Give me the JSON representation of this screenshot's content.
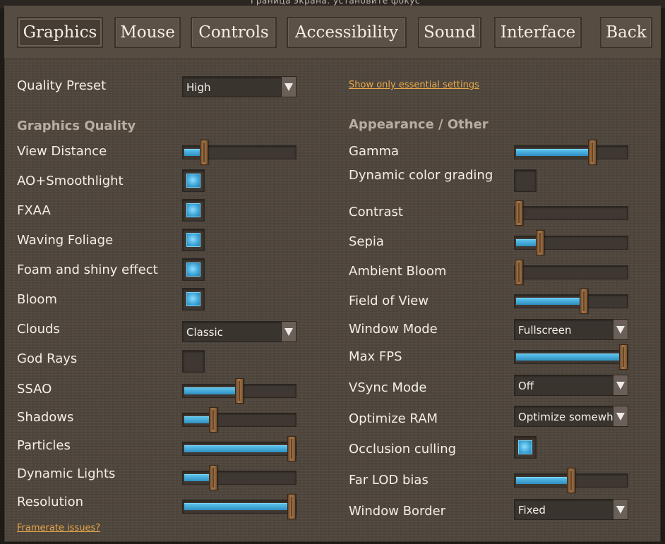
{
  "window": {
    "title_fragment": "Граница экрана: установите фокус"
  },
  "tabs": [
    {
      "label": "Graphics",
      "active": true
    },
    {
      "label": "Mouse",
      "active": false
    },
    {
      "label": "Controls",
      "active": false
    },
    {
      "label": "Accessibility",
      "active": false
    },
    {
      "label": "Sound",
      "active": false
    },
    {
      "label": "Interface",
      "active": false
    }
  ],
  "back_label": "Back",
  "quality_preset": {
    "label": "Quality Preset",
    "value": "High"
  },
  "essential_link": "Show only essential settings",
  "left": {
    "section_title": "Graphics Quality",
    "view_distance": {
      "label": "View Distance",
      "level": 0.16
    },
    "ao_smoothlight": {
      "label": "AO+Smoothlight",
      "checked": true
    },
    "fxaa": {
      "label": "FXAA",
      "checked": true
    },
    "waving_foliage": {
      "label": "Waving Foliage",
      "checked": true
    },
    "foam": {
      "label": "Foam and shiny effect",
      "checked": true
    },
    "bloom": {
      "label": "Bloom",
      "checked": true
    },
    "clouds": {
      "label": "Clouds",
      "value": "Classic"
    },
    "god_rays": {
      "label": "God Rays",
      "checked": false
    },
    "ssao": {
      "label": "SSAO",
      "level": 0.5
    },
    "shadows": {
      "label": "Shadows",
      "level": 0.25
    },
    "particles": {
      "label": "Particles",
      "level": 1.0
    },
    "dynamic_lights": {
      "label": "Dynamic Lights",
      "level": 0.25
    },
    "resolution": {
      "label": "Resolution",
      "level": 1.0
    },
    "framerate_link": "Framerate issues?"
  },
  "right": {
    "section_title": "Appearance / Other",
    "gamma": {
      "label": "Gamma",
      "level": 0.7
    },
    "color_grading": {
      "label": "Dynamic color grading",
      "checked": false
    },
    "contrast": {
      "label": "Contrast",
      "level": 0.0
    },
    "sepia": {
      "label": "Sepia",
      "level": 0.2
    },
    "ambient_bloom": {
      "label": "Ambient Bloom",
      "level": 0.0
    },
    "fov": {
      "label": "Field of View",
      "level": 0.62
    },
    "window_mode": {
      "label": "Window Mode",
      "value": "Fullscreen"
    },
    "max_fps": {
      "label": "Max FPS",
      "level": 1.0
    },
    "vsync": {
      "label": "VSync Mode",
      "value": "Off"
    },
    "optimize_ram": {
      "label": "Optimize RAM",
      "value": "Optimize somewhat"
    },
    "occlusion": {
      "label": "Occlusion culling",
      "checked": true
    },
    "far_lod": {
      "label": "Far LOD bias",
      "level": 0.5
    },
    "window_border": {
      "label": "Window Border",
      "value": "Fixed"
    }
  },
  "colors": {
    "slider_fill": "#3ba4d6",
    "link": "#e7a84a",
    "panel": "#4f463d"
  }
}
